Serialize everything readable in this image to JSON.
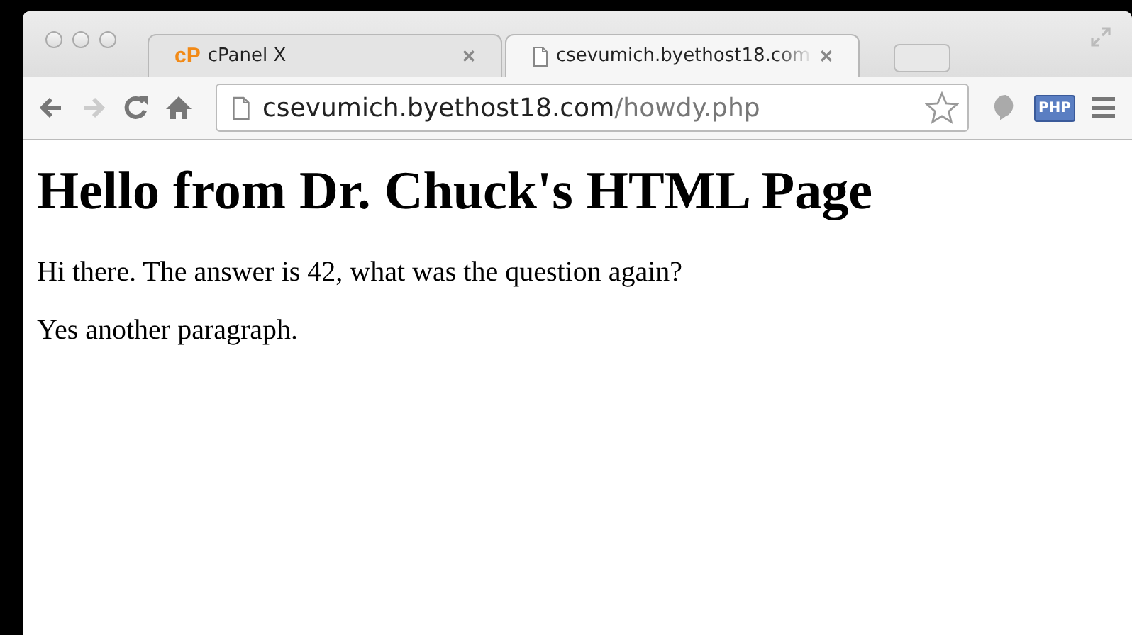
{
  "tabs": [
    {
      "logo": "cP",
      "title": "cPanel X",
      "selected": false,
      "kind": "logo"
    },
    {
      "title": "csevumich.byethost18.com",
      "selected": true,
      "kind": "page"
    }
  ],
  "address_bar": {
    "host": "csevumich.byethost18.com",
    "path": "/howdy.php"
  },
  "extension": {
    "label": "PHP"
  },
  "page": {
    "heading": "Hello from Dr. Chuck's HTML Page",
    "paragraphs": [
      "Hi there. The answer is 42, what was the question again?",
      "Yes another paragraph."
    ]
  }
}
